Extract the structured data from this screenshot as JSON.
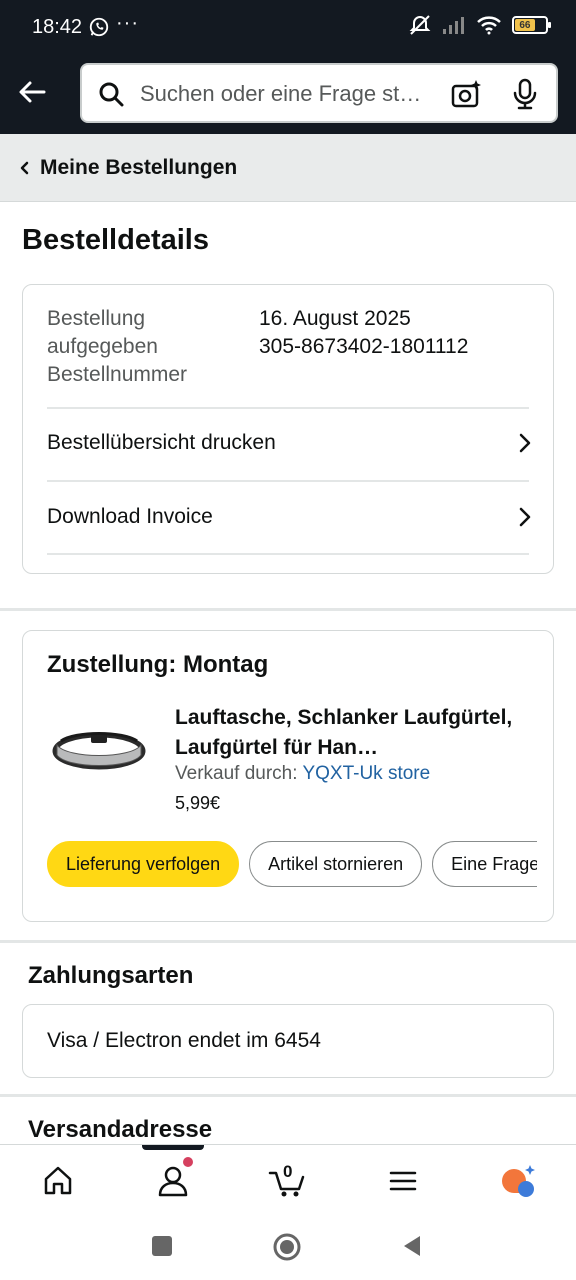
{
  "status_bar": {
    "time": "18:42",
    "dots": "···",
    "battery": "66"
  },
  "search": {
    "placeholder": "Suchen oder eine Frage st…"
  },
  "breadcrumb": {
    "label": "Meine Bestellungen"
  },
  "page": {
    "title": "Bestelldetails"
  },
  "order": {
    "label_placed": "Bestellung aufgegeben",
    "label_number": "Bestellnummer",
    "date": "16. August 2025",
    "number": "305-8673402-1801112",
    "links": [
      {
        "label": "Bestellübersicht drucken"
      },
      {
        "label": "Download Invoice"
      }
    ]
  },
  "delivery": {
    "title": "Zustellung: Montag",
    "product_title": "Lauftasche, Schlanker Laufgürtel, Laufgürtel für Han…",
    "seller_prefix": "Verkauf durch: ",
    "seller_name": "YQXT-Uk store",
    "price": "5,99€",
    "buttons": {
      "track": "Lieferung verfolgen",
      "cancel": "Artikel stornieren",
      "question": "Eine Frage stellen"
    }
  },
  "payment": {
    "heading": "Zahlungsarten",
    "method": "Visa / Electron",
    "ending": "endet im 6454"
  },
  "shipping": {
    "heading": "Versandadresse"
  },
  "bottom_nav": {
    "cart_count": "0"
  },
  "colors": {
    "header": "#131921",
    "primary_button": "#ffd814",
    "link": "#2162a1",
    "badge": "#d5405f"
  }
}
